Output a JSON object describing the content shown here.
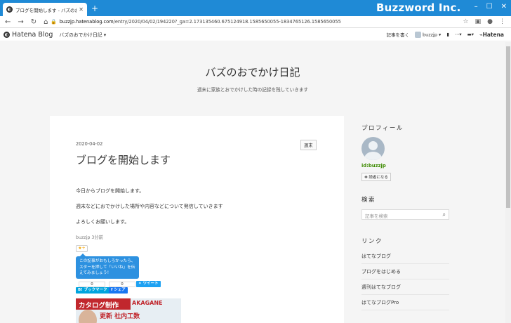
{
  "window": {
    "tab_title": "ブログを開始します - バズのおでかけ日記",
    "brand": "Buzzword Inc.",
    "url_host": "buzzjp.hatenablog.com",
    "url_path": "/entry/2020/04/02/194220?_ga=2.173135460.675124918.1585650055-1834765126.1585650055"
  },
  "hatena_bar": {
    "logo": "Hatena Blog",
    "blog_select": "バズのおでかけ日記",
    "write": "記事を書く",
    "user": "buzzjp",
    "hatena": "Hatena"
  },
  "blog": {
    "title": "バズのおでかけ日記",
    "description": "週末に家族とおでかけした時の記録を残していきます"
  },
  "entry": {
    "date": "2020-04-02",
    "category": "週末",
    "title": "ブログを開始します",
    "paragraphs": [
      "今日からブログを開始します。",
      "週末などにおでかけした場所や内容などについて発信していきます",
      "よろしくお願いします。"
    ],
    "meta": "buzzjp 3分前",
    "star": "★+",
    "tooltip": "この記事がおもしろかったら、スターを押して「いいね」を伝えてみましょう！",
    "counts": [
      "0",
      "0"
    ],
    "share": {
      "bookmark": "B! ブックマーク",
      "facebook": "f シェア",
      "tweet": "ツイート"
    },
    "ad": {
      "line1": "カタログ制作",
      "brand": "AKAGANE",
      "line2": "更新 社内工数"
    }
  },
  "sidebar": {
    "profile_title": "プロフィール",
    "user_id": "id:buzzjp",
    "reader_button": "読者になる",
    "search_title": "検索",
    "search_placeholder": "記事を検索",
    "links_title": "リンク",
    "links": [
      "はてなブログ",
      "ブログをはじめる",
      "週刊はてなブログ",
      "はてなブログPro"
    ]
  },
  "colors": {
    "titlebar": "#1f8ad6",
    "tooltip": "#2d91e0",
    "user_id": "#3d8b00"
  }
}
